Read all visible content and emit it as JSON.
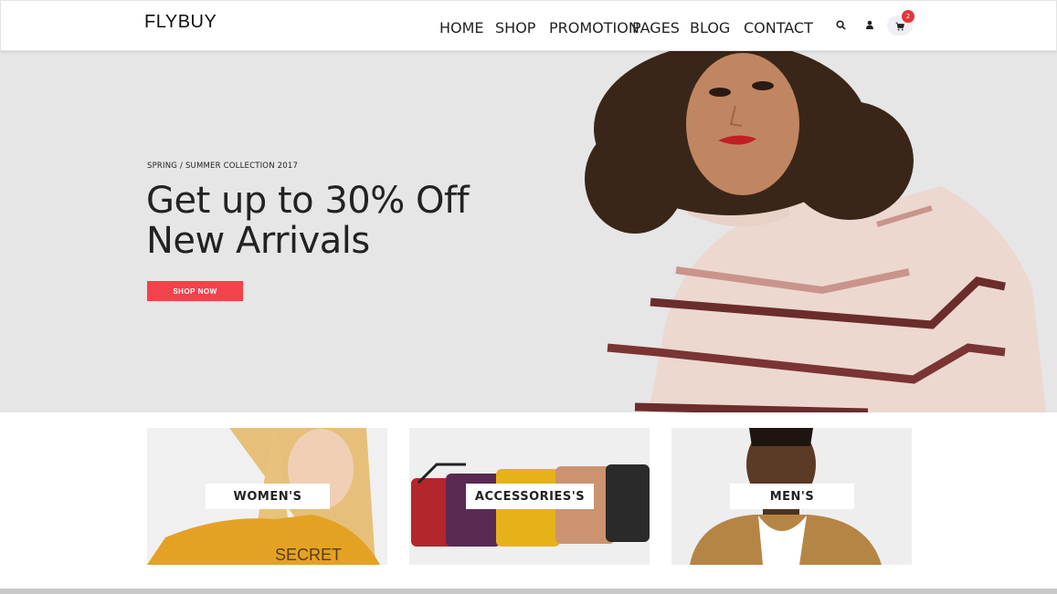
{
  "header": {
    "logo": "FLYBUY",
    "nav": [
      "HOME",
      "SHOP",
      "PROMOTION",
      "PAGES",
      "BLOG",
      "CONTACT"
    ],
    "cart_count": "2",
    "icons": [
      "search-icon",
      "user-icon",
      "cart-icon"
    ]
  },
  "hero": {
    "subtitle": "SPRING / SUMMER COLLECTION 2017",
    "title_line1": "Get up to 30% Off",
    "title_line2": "New Arrivals",
    "cta": "SHOP NOW"
  },
  "categories": [
    {
      "label": "WOMEN'S"
    },
    {
      "label": "ACCESSORIES'S"
    },
    {
      "label": "MEN'S"
    }
  ],
  "colors": {
    "accent": "#f2424c",
    "hero_bg": "#e6e6e6",
    "badge": "#e5343d"
  }
}
